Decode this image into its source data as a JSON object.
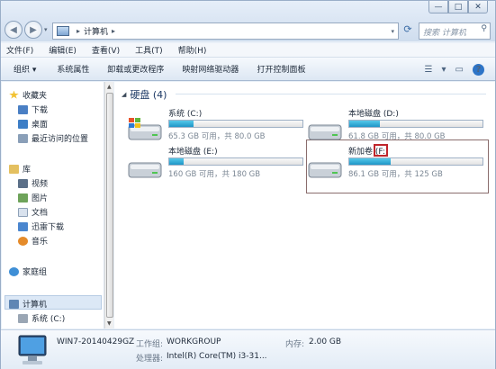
{
  "address": {
    "segments": [
      "计算机"
    ]
  },
  "search": {
    "placeholder": "搜索 计算机"
  },
  "window_controls": {
    "minimize": "—",
    "maximize": "□",
    "close": "✕"
  },
  "menu": [
    "文件(F)",
    "编辑(E)",
    "查看(V)",
    "工具(T)",
    "帮助(H)"
  ],
  "toolbar": {
    "items": [
      "组织 ▾",
      "系统属性",
      "卸载或更改程序",
      "映射网络驱动器",
      "打开控制面板"
    ],
    "view_icon": "☰",
    "view_dropdown": "▾",
    "layout_icon": "▭",
    "help_icon": "?"
  },
  "sidebar": {
    "favorites": "收藏夹",
    "fav_items": [
      "下载",
      "桌面",
      "最近访问的位置"
    ],
    "libraries": "库",
    "lib_items": [
      "视频",
      "图片",
      "文档",
      "迅雷下载",
      "音乐"
    ],
    "homegroup": "家庭组",
    "computer": "计算机",
    "computer_items": [
      "系统 (C:)"
    ]
  },
  "content": {
    "group_label": "硬盘 (4)"
  },
  "drives": [
    {
      "name": "系统 (C:)",
      "info": "65.3 GB 可用，共 80.0 GB",
      "used_fraction": 0.18,
      "color": "#2b9fd0"
    },
    {
      "name": "本地磁盘 (D:)",
      "info": "61.8 GB 可用，共 80.0 GB",
      "used_fraction": 0.23,
      "color": "#2b9fd0"
    },
    {
      "name": "本地磁盘 (E:)",
      "info": "160 GB 可用，共 180 GB",
      "used_fraction": 0.11,
      "color": "#2b9fd0"
    },
    {
      "name": "新加卷 (F:)",
      "info": "86.1 GB 可用，共 125 GB",
      "used_fraction": 0.31,
      "color": "#2b9fd0"
    }
  ],
  "details": {
    "computer_name": "WIN7-20140429GZ",
    "workgroup_label": "工作组:",
    "workgroup_value": "WORKGROUP",
    "memory_label": "内存:",
    "memory_value": "2.00 GB",
    "processor_label": "处理器:",
    "processor_value": "Intel(R) Core(TM) i3-31..."
  }
}
